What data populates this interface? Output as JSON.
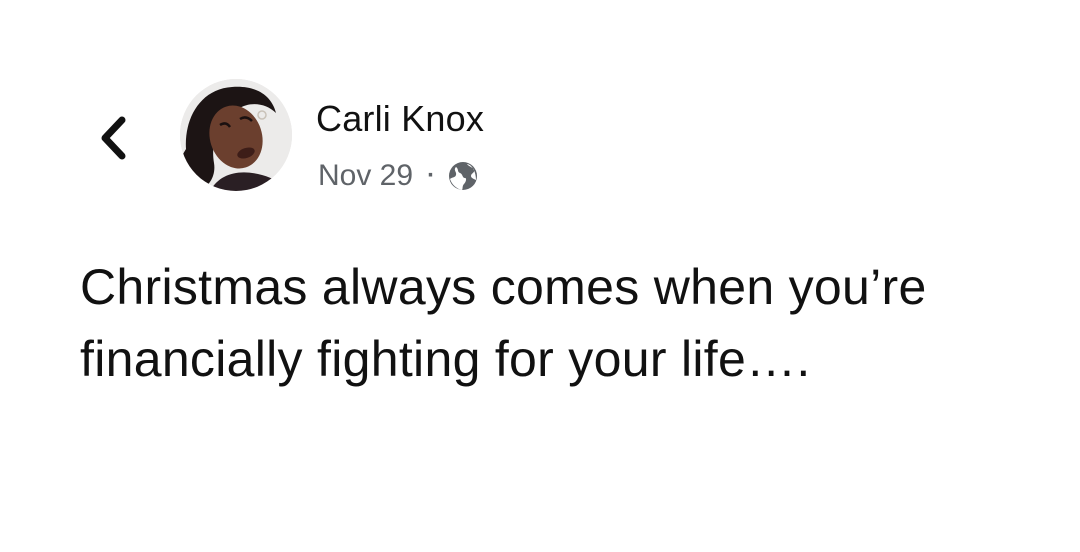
{
  "post": {
    "author": "Carli Knox",
    "date": "Nov 29",
    "separator": "·",
    "audience_icon": "globe-icon",
    "text": "Christmas always comes when you’re financially fighting for your life…."
  },
  "nav": {
    "back_icon": "chevron-left-icon"
  },
  "colors": {
    "text": "#111111",
    "meta_text": "#5f6368",
    "background": "#ffffff"
  }
}
